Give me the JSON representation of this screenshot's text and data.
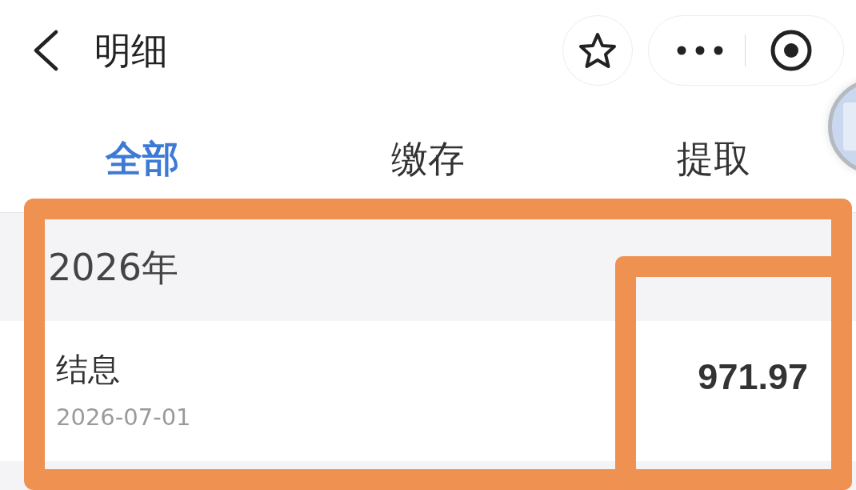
{
  "header": {
    "title": "明细"
  },
  "tabs": [
    {
      "label": "全部",
      "selected": true
    },
    {
      "label": "缴存",
      "selected": false
    },
    {
      "label": "提取",
      "selected": false
    }
  ],
  "sections": [
    {
      "year": "2026年",
      "highlighted": true,
      "rows": [
        {
          "title": "结息",
          "date": "2026-07-01",
          "amount": "971.97",
          "amount_highlighted": true
        }
      ]
    }
  ]
}
